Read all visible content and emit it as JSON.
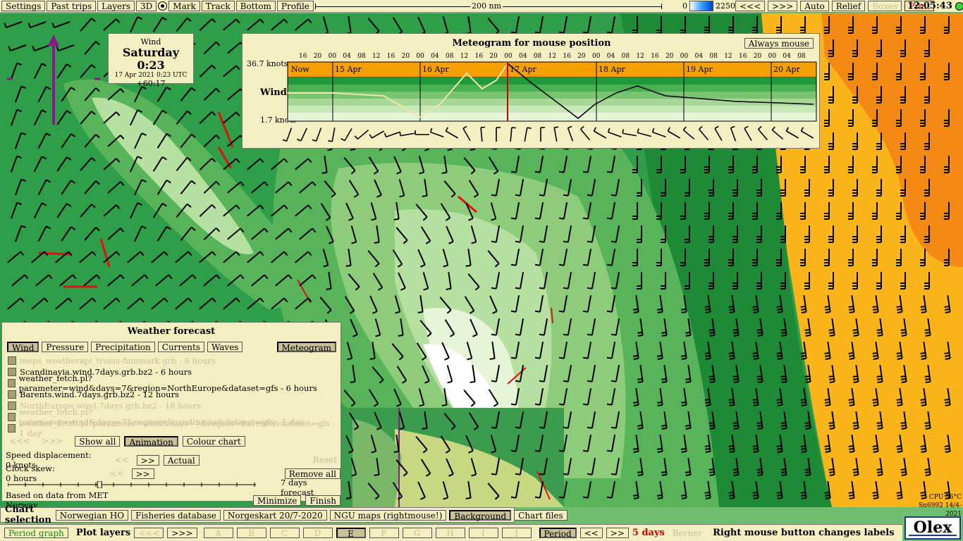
{
  "topbar": {
    "buttons": [
      "Settings",
      "Past trips",
      "Layers",
      "3D",
      "Mark",
      "Track",
      "Bottom",
      "Profile"
    ],
    "scale_label": "200 nm",
    "depth_min": "0",
    "depth_max": "2250",
    "right_buttons": [
      "<<<",
      ">>>",
      "Auto",
      "Relief",
      "Boxes",
      "Print"
    ],
    "clock": "12:05:43"
  },
  "wind_info": {
    "label": "Wind",
    "day_time": "Saturday 0:23",
    "date_utc": "17 Apr 2021 0:23 UTC",
    "offset": "+60:17"
  },
  "meteogram": {
    "title": "Meteogram for mouse position",
    "always_mouse": "Always mouse",
    "hour_ticks": [
      "16",
      "20",
      "00",
      "04",
      "08",
      "12",
      "16",
      "20",
      "00",
      "04",
      "08",
      "12",
      "16",
      "20",
      "00",
      "04",
      "08",
      "12",
      "16",
      "20",
      "00",
      "04",
      "08",
      "12",
      "16",
      "20",
      "00",
      "04",
      "08",
      "12",
      "16",
      "20",
      "00",
      "04",
      "08"
    ],
    "day_labels": [
      "Now",
      "15 Apr",
      "16 Apr",
      "17 Apr",
      "18 Apr",
      "19 Apr",
      "20 Apr"
    ],
    "y_max_label": "36.7 knots",
    "y_min_label": "1.7 knots",
    "row_label": "Wind",
    "colors": {
      "orange": "#f4a000",
      "green_dark": "#1e9a3c",
      "green_light": "#d8f0c8"
    }
  },
  "weather_forecast": {
    "title": "Weather forecast",
    "tabs": [
      "Wind",
      "Pressure",
      "Precipitation",
      "Currents",
      "Waves"
    ],
    "meteogram_button": "Meteogram",
    "files": [
      {
        "name": "meps_weatherapi_troms-finnmark.grb - 6 hours",
        "dim": true
      },
      {
        "name": "Scandinavia.wind.7days.grb.bz2 - 6 hours",
        "dim": false
      },
      {
        "name": "weather_fetch.pl?parameter=wind&days=7&region=NorthEurope&dataset=gfs - 6 hours",
        "dim": false
      },
      {
        "name": "Barents.wind.7days.grb.bz2 - 12 hours",
        "dim": false
      },
      {
        "name": "NorthEurope.wind.7days.grb.bz2 - 18 hours",
        "dim": true
      },
      {
        "name": "weather_fetch.pl?parameter=wind&days=7&region=Scandinavia&dataset=gfs - 1 day",
        "dim": true
      },
      {
        "name": "weather_fetch.pl?parameter=wind&days=7&region=Barents&dataset=gfs - 1 day",
        "dim": true
      }
    ],
    "nav_prev": "<<<",
    "nav_next": ">>>",
    "show_all": "Show all",
    "animation": "Animation",
    "colour_chart": "Colour chart",
    "speed_displacement": "Speed displacement: 0 knots",
    "speed_prev": "<<",
    "speed_next": ">>",
    "actual": "Actual",
    "reset": "Reset",
    "clock_skew": "Clock skew: 0 hours",
    "skew_prev": "<<",
    "skew_next": ">>",
    "remove_all": "Remove all",
    "forecast_days": "7 days forecast",
    "slider_position": 0.37,
    "source": "Based on data from MET Norway",
    "minimize": "Minimize",
    "finish": "Finish"
  },
  "chart_selection": {
    "label": "Chart selection",
    "buttons": [
      "Norwegian HO",
      "Fisheries database",
      "Norgeskart 20/7-2020",
      "NGU maps (rightmouse!)",
      "Background",
      "Chart files"
    ]
  },
  "bottombar": {
    "period_graph": "Period graph",
    "plot_layers": "Plot layers",
    "prev": "<<<",
    "next": ">>>",
    "layers": [
      "A",
      "B",
      "C",
      "D",
      "E",
      "F",
      "G",
      "H",
      "I",
      "J"
    ],
    "period": "Period",
    "p_prev": "<<",
    "p_next": ">>",
    "days": "5 days",
    "berner": "Berner",
    "info": "Right mouse button changes labels"
  },
  "status": {
    "cpu": "CPU 56°C",
    "build": "Sn6992 14/4-2021"
  },
  "logo": "Olex"
}
